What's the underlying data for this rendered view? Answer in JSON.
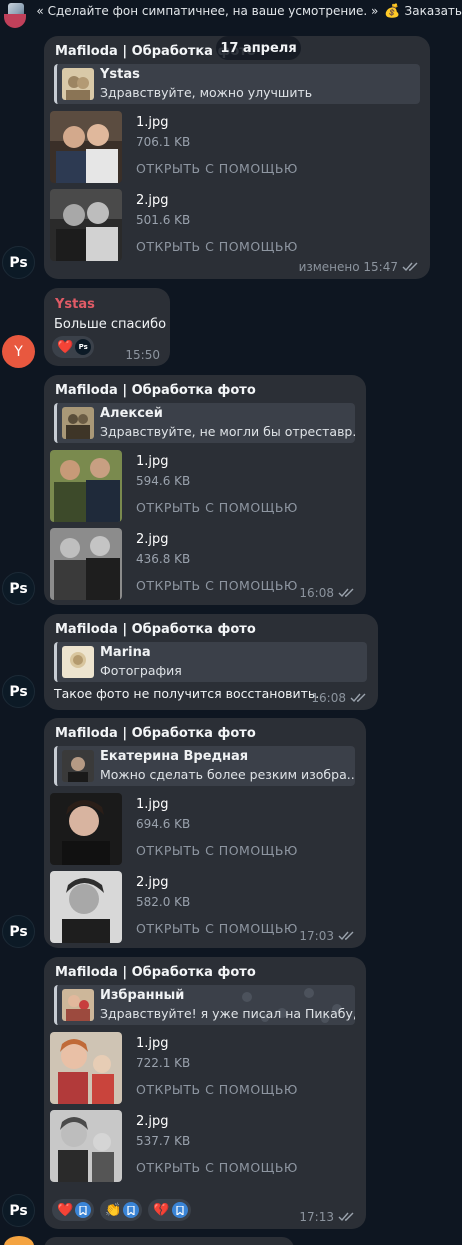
{
  "header": {
    "preview_text": "« Сделайте фон симпатичнее, на ваше усмотрение. »",
    "money_icon": "money-bag-icon",
    "order_text": "Заказать"
  },
  "date_label": "17 апреля",
  "messages": [
    {
      "sender": "Mafiloda | Обработка фото",
      "quote": {
        "name": "Ystas",
        "text": "Здравствуйте, можно улучшить"
      },
      "files": [
        {
          "name": "1.jpg",
          "size": "706.1 KB",
          "open": "ОТКРЫТЬ С ПОМОЩЬЮ"
        },
        {
          "name": "2.jpg",
          "size": "501.6 KB",
          "open": "ОТКРЫТЬ С ПОМОЩЬЮ"
        }
      ],
      "time": "изменено 15:47",
      "avatar": "Ps"
    },
    {
      "sender": "Ystas",
      "text": "Больше спасибо",
      "reaction": "❤️",
      "reaction_badge": "Ps",
      "time": "15:50",
      "avatar": "Y"
    },
    {
      "sender": "Mafiloda | Обработка фото",
      "quote": {
        "name": "Алексей",
        "text": "Здравствуйте, не могли бы отреставр..."
      },
      "files": [
        {
          "name": "1.jpg",
          "size": "594.6 KB",
          "open": "ОТКРЫТЬ С ПОМОЩЬЮ"
        },
        {
          "name": "2.jpg",
          "size": "436.8 KB",
          "open": "ОТКРЫТЬ С ПОМОЩЬЮ"
        }
      ],
      "time": "16:08",
      "avatar": "Ps"
    },
    {
      "sender": "Mafiloda | Обработка фото",
      "quote": {
        "name": "Marina",
        "text": "Фотография"
      },
      "text": "Такое фото не получится восстановить.",
      "time": "16:08",
      "avatar": "Ps"
    },
    {
      "sender": "Mafiloda | Обработка фото",
      "quote": {
        "name": "Екатерина Вредная",
        "text": "Можно сделать более резким изобра..."
      },
      "files": [
        {
          "name": "1.jpg",
          "size": "694.6 KB",
          "open": "ОТКРЫТЬ С ПОМОЩЬЮ"
        },
        {
          "name": "2.jpg",
          "size": "582.0 KB",
          "open": "ОТКРЫТЬ С ПОМОЩЬЮ"
        }
      ],
      "time": "17:03",
      "avatar": "Ps"
    },
    {
      "sender": "Mafiloda | Обработка фото",
      "quote": {
        "name": "Избранный",
        "text": "Здравствуйте! я уже писал на Пикабу, ..."
      },
      "files": [
        {
          "name": "1.jpg",
          "size": "722.1 KB",
          "open": "ОТКРЫТЬ С ПОМОЩЬЮ"
        },
        {
          "name": "2.jpg",
          "size": "537.7 KB",
          "open": "ОТКРЫТЬ С ПОМОЩЬЮ"
        }
      ],
      "reactions": [
        "❤️",
        "👏",
        "💔"
      ],
      "time": "17:13",
      "avatar": "Ps"
    }
  ],
  "colors": {
    "background": "#0e1621",
    "bubble": "#2b2f36",
    "quote": "#3b4049",
    "sender_red": "#e05b66",
    "avatar_y": "#e8583f"
  }
}
